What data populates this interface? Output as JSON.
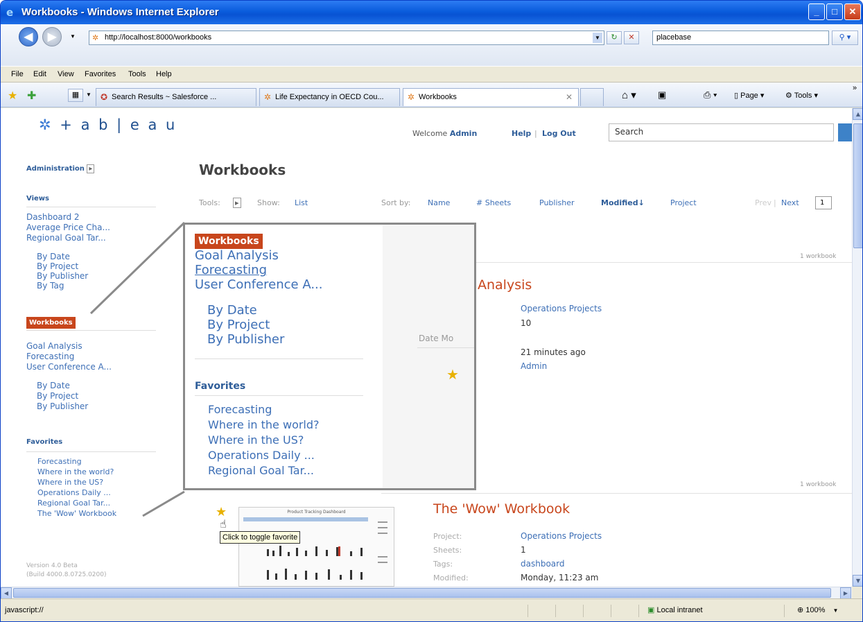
{
  "window": {
    "title": "Workbooks - Windows Internet Explorer"
  },
  "browser": {
    "url": "http://localhost:8000/workbooks",
    "search_value": "placebase",
    "menu": [
      "File",
      "Edit",
      "View",
      "Favorites",
      "Tools",
      "Help"
    ],
    "tabs": [
      {
        "label": "Search Results ~ Salesforce ..."
      },
      {
        "label": "Life Expectancy in OECD Cou..."
      },
      {
        "label": "Workbooks"
      }
    ],
    "toolbar": {
      "page_label": "Page",
      "tools_label": "Tools"
    },
    "status": {
      "left": "javascript://",
      "zone": "Local intranet",
      "zoom": "100%"
    }
  },
  "app": {
    "logo_text": "+ a b | e a u",
    "welcome_prefix": "Welcome",
    "user": "Admin",
    "help": "Help",
    "sep": "|",
    "logout": "Log Out",
    "search_value": "Search",
    "page_title": "Workbooks",
    "tools_label": "Tools:",
    "show_label": "Show:",
    "show_value": "List",
    "sort_label": "Sort by:",
    "sort_options": [
      "Name",
      "# Sheets",
      "Publisher",
      "Modified",
      "Project"
    ],
    "sort_arrow": "↓",
    "prev": "Prev",
    "next": "Next",
    "page_number": "1",
    "count_text": "1 workbook"
  },
  "sidebar": {
    "administration": "Administration",
    "views_heading": "Views",
    "views": [
      "Dashboard 2",
      "Average Price Cha...",
      "Regional Goal Tar..."
    ],
    "views_sub": [
      "By Date",
      "By Project",
      "By Publisher",
      "By Tag"
    ],
    "workbooks_heading": "Workbooks",
    "workbooks": [
      "Goal Analysis",
      "Forecasting",
      "User Conference A..."
    ],
    "workbooks_sub": [
      "By Date",
      "By Project",
      "By Publisher"
    ],
    "favorites_heading": "Favorites",
    "favorites": [
      "Forecasting",
      "Where in the world?",
      "Where in the US?",
      "Operations Daily ...",
      "Regional Goal Tar...",
      "The 'Wow' Workbook"
    ],
    "version": "Version 4.0 Beta",
    "build": "(Build 4000.8.0725.0200)"
  },
  "callout": {
    "heading": "Workbooks",
    "items": [
      "Goal Analysis",
      "Forecasting",
      "User Conference A..."
    ],
    "sub": [
      "By Date",
      "By Project",
      "By Publisher"
    ],
    "favorites_heading": "Favorites",
    "favorites": [
      "Forecasting",
      "Where in the world?",
      "Where in the US?",
      "Operations Daily ...",
      "Regional Goal Tar..."
    ],
    "date_partial": "Date Mo"
  },
  "workbook1": {
    "title_partial": "Analysis",
    "project": "Operations Projects",
    "sheets": "10",
    "modified": "21 minutes ago",
    "publisher": "Admin"
  },
  "workbook2": {
    "title": "The 'Wow' Workbook",
    "labels": [
      "Project:",
      "Sheets:",
      "Tags:",
      "Modified:"
    ],
    "project": "Operations Projects",
    "sheets": "1",
    "tags": "dashboard",
    "modified": "Monday, 11:23 am",
    "thumbnail_title": "Product Tracking Dashboard"
  },
  "tooltip": "Click to toggle favorite",
  "colors": {
    "accent": "#c8461c",
    "link": "#3d6fb6",
    "titlebar": "#0a5cdc"
  }
}
